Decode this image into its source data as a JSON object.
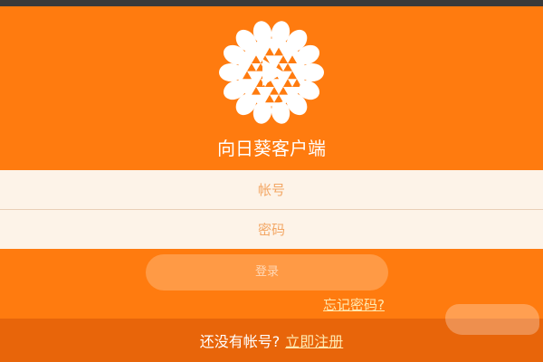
{
  "app": {
    "title": "向日葵客户端",
    "logo_icon": "sunflower-play-logo-icon"
  },
  "form": {
    "account_placeholder": "帐号",
    "password_placeholder": "密码",
    "login_label": "登录",
    "forgot_label": "忘记密码?"
  },
  "footer": {
    "prompt": "还没有帐号?",
    "register_label": "立即注册"
  },
  "colors": {
    "background": "#ff7b0f",
    "input_bg": "#fdf3e8",
    "footer_bg": "#e8650a",
    "link": "#ffe9b0"
  }
}
